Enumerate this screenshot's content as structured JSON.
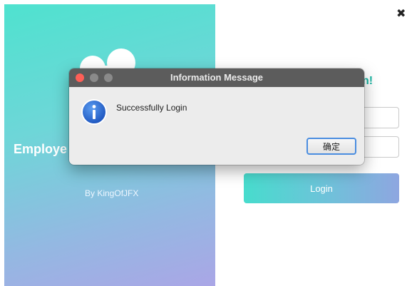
{
  "left_panel": {
    "app_name": "Employe",
    "byline": "By KingOfJFX",
    "logo_icon": "bubbles-logo-icon"
  },
  "window": {
    "close_icon": "close-icon",
    "close_glyph": "✖"
  },
  "form": {
    "welcome_fragment": "n!",
    "login_label": "Login"
  },
  "dialog": {
    "title": "Information Message",
    "message": "Successfully Login",
    "ok_label": "确定",
    "icon": "info-icon"
  },
  "colors": {
    "accent": "#17b6a3",
    "info_blue": "#2f6fd6",
    "dialog_titlebar": "#5c5c5c",
    "close_red": "#ff5f57"
  }
}
